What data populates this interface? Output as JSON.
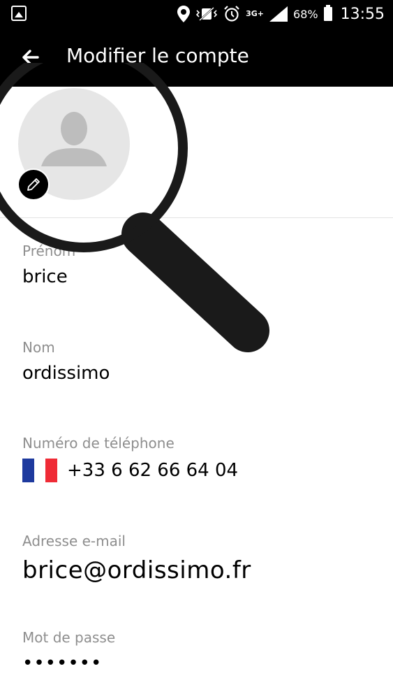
{
  "status_bar": {
    "network": "3G+",
    "battery_percent": "68%",
    "time": "13:55"
  },
  "app_bar": {
    "title": "Modifier le compte"
  },
  "fields": {
    "first_name": {
      "label": "Prénom",
      "value": "brice"
    },
    "last_name": {
      "label": "Nom",
      "value": "ordissimo"
    },
    "phone": {
      "label": "Numéro de téléphone",
      "value": "+33 6 62 66 64 04",
      "flag_colors": [
        "#1e3a9e",
        "#ffffff",
        "#ef2b36"
      ]
    },
    "email": {
      "label": "Adresse e-mail",
      "value": "brice@ordissimo.fr"
    },
    "password": {
      "label": "Mot de passe",
      "value": "•••••••"
    }
  },
  "icons": {
    "gallery": "gallery-icon",
    "location": "location-icon",
    "vibrate": "vibrate-icon",
    "alarm": "alarm-icon",
    "signal": "signal-icon",
    "battery": "battery-icon",
    "back": "back-arrow-icon",
    "avatar": "avatar-placeholder-icon",
    "edit": "pencil-icon",
    "magnifier": "magnifier-icon"
  }
}
